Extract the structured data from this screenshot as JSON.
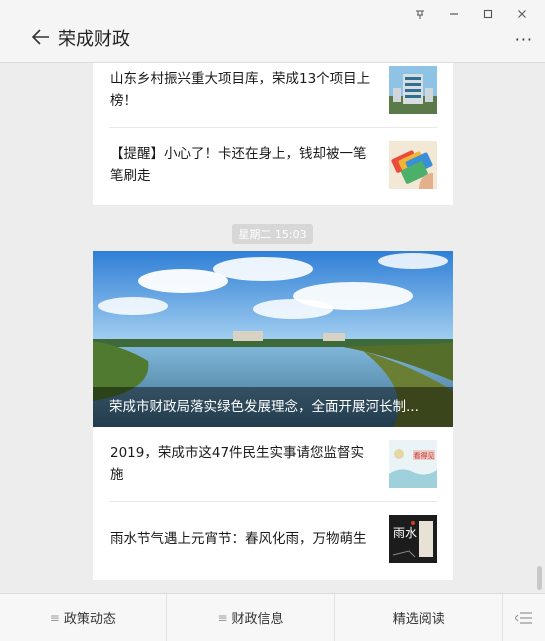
{
  "window": {
    "pin_icon": "pin-icon",
    "min": "—",
    "max": "☐",
    "close": "✕"
  },
  "header": {
    "title": "荣成财政",
    "more": "···"
  },
  "top_card": {
    "items": [
      {
        "text": "山东乡村振兴重大项目库，荣成13个项目上榜！"
      },
      {
        "text": "【提醒】小心了！卡还在身上，钱却被一笔笔刷走"
      }
    ]
  },
  "timestamp": "星期二 15:03",
  "main_card": {
    "hero_title": "荣成市财政局落实绿色发展理念，全面开展河长制...",
    "items": [
      {
        "text": "2019，荣成市这47件民生实事请您监督实施"
      },
      {
        "text": "雨水节气遇上元宵节：春风化雨，万物萌生"
      }
    ]
  },
  "nav": {
    "tab1": "政策动态",
    "tab2": "财政信息",
    "tab3": "精选阅读",
    "menu_glyph": "≡"
  },
  "thumbs": {
    "t3_text": "看得见",
    "t4_text": "雨水"
  }
}
